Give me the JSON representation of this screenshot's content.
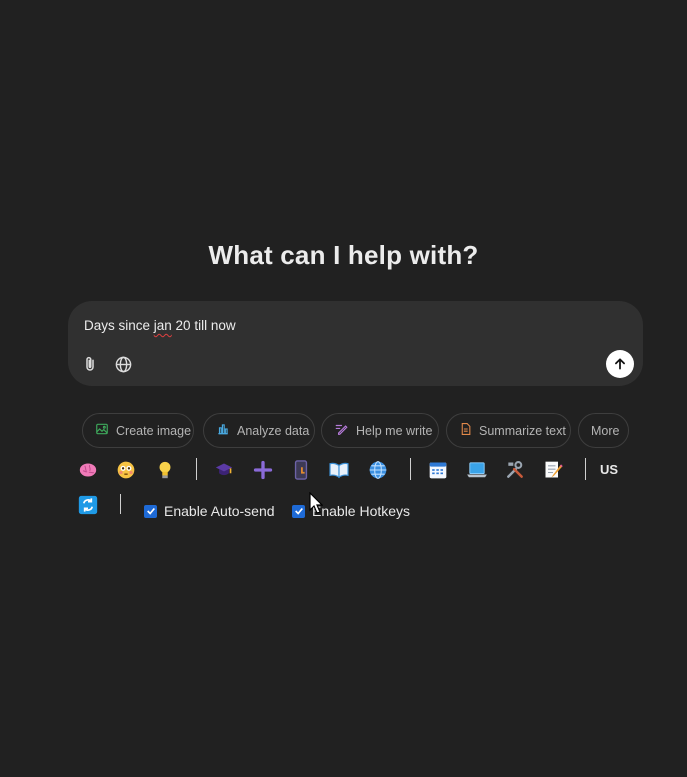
{
  "headline": "What can I help with?",
  "composer": {
    "text_before": "Days since ",
    "text_misspelled": "jan",
    "text_after": " 20 till now"
  },
  "chips": [
    {
      "label": "Create image",
      "icon": "image-icon",
      "color": "#3ea85b"
    },
    {
      "label": "Analyze data",
      "icon": "bar-chart-icon",
      "color": "#49a9e0"
    },
    {
      "label": "Help me write",
      "icon": "pen-icon",
      "color": "#b57ad9"
    },
    {
      "label": "Summarize text",
      "icon": "document-icon",
      "color": "#e2894a"
    },
    {
      "label": "More"
    }
  ],
  "toolbar": {
    "language": "US",
    "icons": [
      "brain-icon",
      "flushed-face-icon",
      "lightbulb-icon",
      "graduation-cap-icon",
      "plus-icon",
      "phone-icon",
      "book-icon",
      "globe-icon",
      "calendar-icon",
      "laptop-icon",
      "tools-icon",
      "memo-icon",
      "refresh-icon"
    ]
  },
  "options": {
    "auto_send": "Enable Auto-send",
    "hotkeys": "Enable Hotkeys"
  }
}
